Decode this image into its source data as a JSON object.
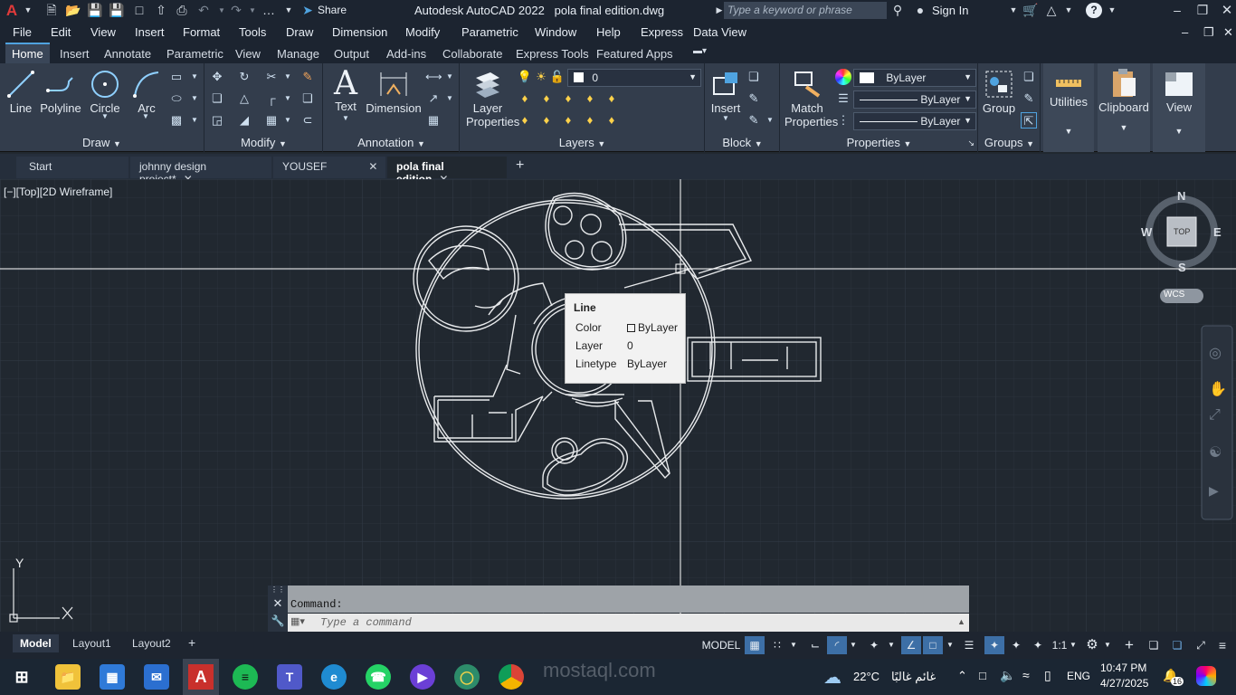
{
  "titlebar": {
    "app_title": "Autodesk AutoCAD 2022",
    "doc_title": "pola final edition.dwg",
    "share_label": "Share",
    "search_placeholder": "Type a keyword or phrase",
    "signin_label": "Sign In"
  },
  "menubar": [
    "File",
    "Edit",
    "View",
    "Insert",
    "Format",
    "Tools",
    "Draw",
    "Dimension",
    "Modify",
    "Parametric",
    "Window",
    "Help",
    "Express",
    "Data View"
  ],
  "ribbon_tabs": [
    "Home",
    "Insert",
    "Annotate",
    "Parametric",
    "View",
    "Manage",
    "Output",
    "Add-ins",
    "Collaborate",
    "Express Tools",
    "Featured Apps"
  ],
  "ribbon": {
    "draw": {
      "label": "Draw",
      "line": "Line",
      "polyline": "Polyline",
      "circle": "Circle",
      "arc": "Arc"
    },
    "modify": {
      "label": "Modify"
    },
    "annotation": {
      "label": "Annotation",
      "text": "Text",
      "dimension": "Dimension"
    },
    "layers": {
      "label": "Layers",
      "layer_properties_1": "Layer",
      "layer_properties_2": "Properties",
      "current_layer": "0"
    },
    "block": {
      "label": "Block",
      "insert": "Insert"
    },
    "properties": {
      "label": "Properties",
      "match_1": "Match",
      "match_2": "Properties",
      "color": "ByLayer",
      "linetype": "ByLayer",
      "lineweight": "ByLayer"
    },
    "groups": {
      "label": "Groups",
      "group": "Group"
    },
    "utilities": "Utilities",
    "clipboard": "Clipboard",
    "view": "View"
  },
  "doc_tabs": [
    {
      "label": "Start",
      "closable": false
    },
    {
      "label": "johnny design project*",
      "closable": true
    },
    {
      "label": "YOUSEF",
      "closable": true
    },
    {
      "label": "pola final edition",
      "closable": true,
      "active": true
    }
  ],
  "viewport": {
    "label": "[−][Top][2D Wireframe]",
    "viewcube": {
      "n": "N",
      "s": "S",
      "e": "E",
      "w": "W",
      "face": "TOP",
      "wcs": "WCS"
    },
    "ucs_y": "Y"
  },
  "tooltip": {
    "title": "Line",
    "rows": [
      {
        "key": "Color",
        "value": "ByLayer"
      },
      {
        "key": "Layer",
        "value": "0"
      },
      {
        "key": "Linetype",
        "value": "ByLayer"
      }
    ]
  },
  "command": {
    "history": "Command:",
    "placeholder": "Type a command"
  },
  "layout_tabs": [
    "Model",
    "Layout1",
    "Layout2"
  ],
  "status": {
    "model": "MODEL",
    "scale": "1:1"
  },
  "taskbar": {
    "weather_temp": "22°C",
    "weather_text": "غائم غالبًا",
    "lang": "ENG",
    "time": "10:47 PM",
    "date": "4/27/2025",
    "notif_count": "16"
  },
  "watermark": "mostaql.com",
  "colors": {
    "accent": "#4fa3e0",
    "canvas": "#212830",
    "ribbon": "#333d4c"
  }
}
